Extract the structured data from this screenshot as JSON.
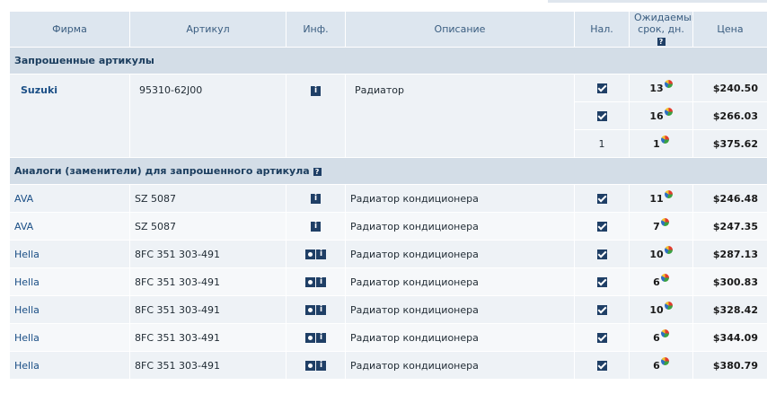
{
  "columns": {
    "brand": "Фирма",
    "article": "Артикул",
    "info": "Инф.",
    "description": "Описание",
    "availability": "Нал.",
    "deadline": "Ожидаемый срок, дн.",
    "price": "Цена"
  },
  "requested": {
    "title": "Запрошенные артикулы",
    "brand": "Suzuki",
    "article": "95310-62J00",
    "description": "Радиатор",
    "offers": [
      {
        "availability": "check",
        "days": "13",
        "price": "$240.50"
      },
      {
        "availability": "check",
        "days": "16",
        "price": "$266.03"
      },
      {
        "availability": "1",
        "days": "1",
        "price": "$375.62"
      }
    ]
  },
  "analogs": {
    "title": "Аналоги (заменители) для запрошенного артикула",
    "rows": [
      {
        "brand": "AVA",
        "article": "SZ 5087",
        "photo": false,
        "description": "Радиатор кондиционера",
        "days": "11",
        "price": "$246.48"
      },
      {
        "brand": "AVA",
        "article": "SZ 5087",
        "photo": false,
        "description": "Радиатор кондиционера",
        "days": "7",
        "price": "$247.35"
      },
      {
        "brand": "Hella",
        "article": "8FC 351 303-491",
        "photo": true,
        "description": "Радиатор кондиционера",
        "days": "10",
        "price": "$287.13"
      },
      {
        "brand": "Hella",
        "article": "8FC 351 303-491",
        "photo": true,
        "description": "Радиатор кондиционера",
        "days": "6",
        "price": "$300.83"
      },
      {
        "brand": "Hella",
        "article": "8FC 351 303-491",
        "photo": true,
        "description": "Радиатор кондиционера",
        "days": "10",
        "price": "$328.42"
      },
      {
        "brand": "Hella",
        "article": "8FC 351 303-491",
        "photo": true,
        "description": "Радиатор кондиционера",
        "days": "6",
        "price": "$344.09"
      },
      {
        "brand": "Hella",
        "article": "8FC 351 303-491",
        "photo": true,
        "description": "Радиатор кондиционера",
        "days": "6",
        "price": "$380.79"
      }
    ]
  },
  "icons": {
    "info": "info-icon",
    "photo": "photo-icon",
    "help": "help-icon",
    "availability": "checkbox-checked-icon",
    "chart": "pie-chart-icon"
  },
  "colors": {
    "header_bg": "#dde6ef",
    "group_bg": "#d3dde7",
    "row_bg": "#eef2f6",
    "link": "#1b4f86"
  }
}
